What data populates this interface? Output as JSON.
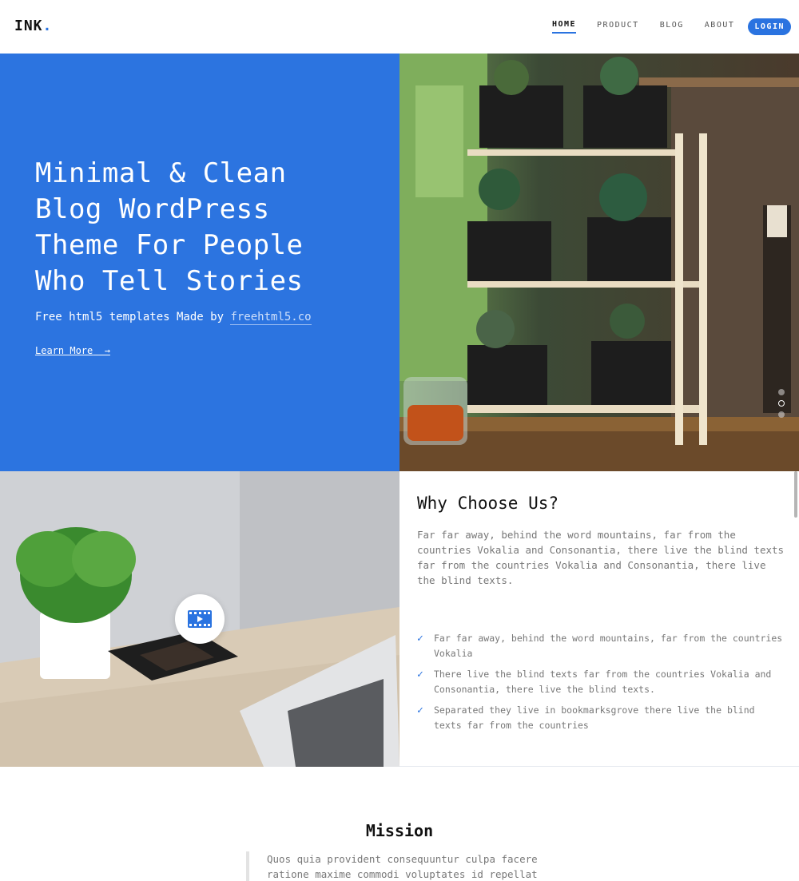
{
  "nav": {
    "logo": "INK",
    "logo_dot": ".",
    "items": [
      {
        "label": "HOME",
        "active": true
      },
      {
        "label": "PRODUCT",
        "active": false
      },
      {
        "label": "BLOG",
        "active": false
      },
      {
        "label": "ABOUT",
        "active": false
      }
    ],
    "login": "LOGIN"
  },
  "hero": {
    "title_lines": [
      "Minimal & Clean",
      "Blog WordPress",
      "Theme For People",
      "Who Tell Stories"
    ],
    "subtitle_prefix": "Free html5 templates Made by",
    "subtitle_link": "freehtml5.co",
    "cta": "Learn More",
    "cta_icon": "arrow-right-icon",
    "slider_dots": 3,
    "slider_active": 2,
    "accent_color": "#2c74e0"
  },
  "video": {
    "play_icon": "film-play-icon"
  },
  "why": {
    "title": "Why Choose Us?",
    "text": "Far far away, behind the word mountains, far from the countries Vokalia and Consonantia, there live the blind texts far from the countries Vokalia and Consonantia, there live the blind texts.",
    "items": [
      "Far far away, behind the word mountains, far from the countries Vokalia",
      "There live the blind texts far from the countries Vokalia and Consonantia, there live the blind texts.",
      "Separated they live in bookmarksgrove there live the blind texts far from the countries"
    ],
    "check_icon": "checkmark-icon"
  },
  "mission": {
    "title": "Mission",
    "quote": "Quos quia provident consequuntur culpa facere ratione maxime commodi voluptates id repellat"
  }
}
